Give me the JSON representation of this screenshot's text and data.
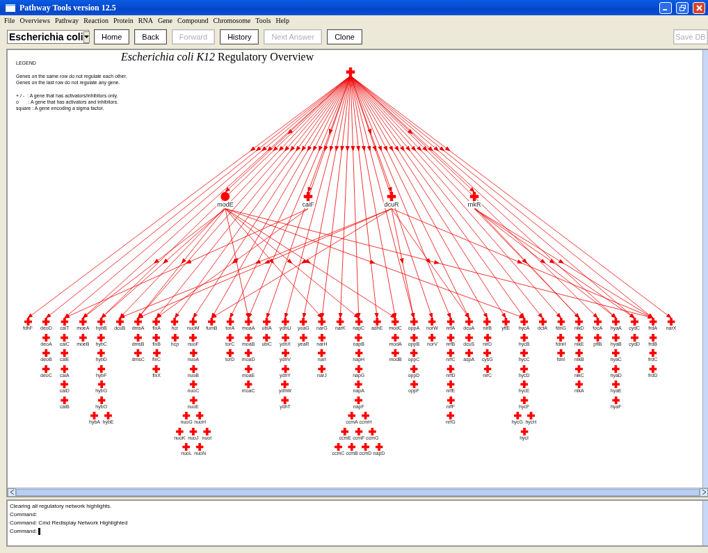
{
  "window": {
    "title": "Pathway Tools version 12.5"
  },
  "menu": [
    "File",
    "Overviews",
    "Pathway",
    "Reaction",
    "Protein",
    "RNA",
    "Gene",
    "Compound",
    "Chromosome",
    "Tools",
    "Help"
  ],
  "toolbar": {
    "organism": "Escherichia coli",
    "buttons": [
      {
        "label": "Home",
        "disabled": false
      },
      {
        "label": "Back",
        "disabled": false
      },
      {
        "label": "Forward",
        "disabled": true
      },
      {
        "label": "History",
        "disabled": false
      },
      {
        "label": "Next Answer",
        "disabled": true
      },
      {
        "label": "Clone",
        "disabled": false
      }
    ],
    "save_button": {
      "label": "Save DB",
      "disabled": true
    }
  },
  "overview": {
    "title": "*Escherichia coli K12* Regulatory Overview",
    "legend": {
      "heading": "LEGEND",
      "notes": [
        "Genes on the same row do not regulate each other.",
        "Genes on the last row do not regulate any gene."
      ],
      "symbols": [
        "+ / -  : A gene that has activators/inhibitors only.",
        "o       : A gene that has activators and inhibitors.",
        "square : A gene encoding a sigma factor."
      ]
    },
    "root": {
      "kind": "plus"
    },
    "regulators": [
      {
        "name": "modE",
        "kind": "circle"
      },
      {
        "name": "caiF",
        "kind": "plus"
      },
      {
        "name": "dcuR",
        "kind": "plus"
      },
      {
        "name": "rnkR",
        "kind": "plus"
      }
    ],
    "operons": [
      {
        "rows": [
          [
            "fdhF"
          ]
        ]
      },
      {
        "rows": [
          [
            "deoD"
          ],
          [
            "deoA"
          ],
          [
            "deoB"
          ],
          [
            "deoC"
          ]
        ]
      },
      {
        "rows": [
          [
            "caiT"
          ],
          [
            "caiC"
          ],
          [
            "caiE"
          ],
          [
            "caiA"
          ],
          [
            "caiD"
          ],
          [
            "caiB"
          ]
        ]
      },
      {
        "rows": [
          [
            "moeA"
          ],
          [
            "moeB"
          ]
        ]
      },
      {
        "rows": [
          [
            "hybB"
          ],
          [
            "hybC"
          ],
          [
            "hybD"
          ],
          [
            "hybF"
          ],
          [
            "hybG"
          ],
          [
            "hybO"
          ],
          [
            "hybA",
            "hybE"
          ]
        ]
      },
      {
        "rows": [
          [
            "dcuB"
          ]
        ]
      },
      {
        "rows": [
          [
            "dmsA"
          ],
          [
            "dmsB"
          ],
          [
            "dmsC"
          ]
        ]
      },
      {
        "rows": [
          [
            "fixA"
          ],
          [
            "fixB"
          ],
          [
            "fixC"
          ],
          [
            "fixX"
          ]
        ]
      },
      {
        "rows": [
          [
            "hcr"
          ],
          [
            "hcp"
          ]
        ]
      },
      {
        "rows": [
          [
            "nuoM"
          ],
          [
            "nuoF"
          ],
          [
            "nuoA"
          ],
          [
            "nuoB"
          ],
          [
            "nuoC"
          ],
          [
            "nuoE"
          ],
          [
            "nuoG",
            "nuoH"
          ],
          [
            "nuoK",
            "nuoJ",
            "nuoI"
          ],
          [
            "nuoL",
            "nuoN"
          ]
        ]
      },
      {
        "rows": [
          [
            "fumB"
          ]
        ]
      },
      {
        "rows": [
          [
            "torA"
          ],
          [
            "torC"
          ],
          [
            "torD"
          ]
        ]
      },
      {
        "rows": [
          [
            "moaA"
          ],
          [
            "moaB"
          ],
          [
            "moaD"
          ],
          [
            "moaE"
          ],
          [
            "moaC"
          ]
        ]
      },
      {
        "rows": [
          [
            "ubiA"
          ],
          [
            "ubiC"
          ]
        ]
      },
      {
        "rows": [
          [
            "ydhU"
          ],
          [
            "ydhX"
          ],
          [
            "ydhV"
          ],
          [
            "ydhY"
          ],
          [
            "ydhW"
          ],
          [
            "ydhT"
          ]
        ]
      },
      {
        "rows": [
          [
            "yoaG"
          ],
          [
            "yeaR"
          ]
        ]
      },
      {
        "rows": [
          [
            "narG"
          ],
          [
            "narH"
          ],
          [
            "narI"
          ],
          [
            "narJ"
          ]
        ]
      },
      {
        "rows": [
          [
            "narK"
          ]
        ]
      },
      {
        "rows": [
          [
            "napC"
          ],
          [
            "napB"
          ],
          [
            "napH"
          ],
          [
            "napG"
          ],
          [
            "napA"
          ],
          [
            "napF"
          ],
          [
            "ccmA",
            "ccmH"
          ],
          [
            "ccmE",
            "ccmF",
            "ccmG"
          ],
          [
            "ccmC",
            "ccmB",
            "ccmD",
            "napD"
          ]
        ]
      },
      {
        "rows": [
          [
            "adhE"
          ]
        ]
      },
      {
        "rows": [
          [
            "modC"
          ],
          [
            "modA"
          ],
          [
            "modB"
          ]
        ]
      },
      {
        "rows": [
          [
            "oppA"
          ],
          [
            "oppB"
          ],
          [
            "oppC"
          ],
          [
            "oppD"
          ],
          [
            "oppF"
          ]
        ]
      },
      {
        "rows": [
          [
            "norW"
          ],
          [
            "norV"
          ]
        ]
      },
      {
        "rows": [
          [
            "nrfA"
          ],
          [
            "nrfB"
          ],
          [
            "nrfC"
          ],
          [
            "nrfD"
          ],
          [
            "nrfE"
          ],
          [
            "nrfF"
          ],
          [
            "nrfG"
          ]
        ]
      },
      {
        "rows": [
          [
            "dcuA"
          ],
          [
            "dcuS"
          ],
          [
            "aspA"
          ]
        ]
      },
      {
        "rows": [
          [
            "nirB"
          ],
          [
            "nirD"
          ],
          [
            "cysG"
          ],
          [
            "nirC"
          ]
        ]
      },
      {
        "rows": [
          [
            "ytfE"
          ]
        ]
      },
      {
        "rows": [
          [
            "hycA"
          ],
          [
            "hycB"
          ],
          [
            "hycC"
          ],
          [
            "hycD"
          ],
          [
            "hycE"
          ],
          [
            "hycF"
          ],
          [
            "hycG",
            "hycH"
          ],
          [
            "hycI"
          ]
        ]
      },
      {
        "rows": [
          [
            "dctA"
          ]
        ]
      },
      {
        "rows": [
          [
            "fdnG"
          ],
          [
            "fdnH"
          ],
          [
            "fdnI"
          ]
        ]
      },
      {
        "rows": [
          [
            "nikD"
          ],
          [
            "nikE"
          ],
          [
            "nikB"
          ],
          [
            "nikC"
          ],
          [
            "nikA"
          ]
        ]
      },
      {
        "rows": [
          [
            "focA"
          ],
          [
            "pflB"
          ]
        ]
      },
      {
        "rows": [
          [
            "hyaA"
          ],
          [
            "hyaB"
          ],
          [
            "hyaC"
          ],
          [
            "hyaD"
          ],
          [
            "hyaE"
          ],
          [
            "hyaF"
          ]
        ]
      },
      {
        "rows": [
          [
            "cydC"
          ],
          [
            "cydD"
          ]
        ]
      },
      {
        "rows": [
          [
            "frdA"
          ],
          [
            "frdB"
          ],
          [
            "frdC"
          ],
          [
            "frdD"
          ]
        ]
      },
      {
        "rows": [
          [
            "narX"
          ]
        ]
      }
    ]
  },
  "console": {
    "lines": [
      "Clearing all regulatory network highlights.",
      "Command:",
      "Command: Cmd Redisplay Network Highlighted",
      "Command:"
    ]
  }
}
